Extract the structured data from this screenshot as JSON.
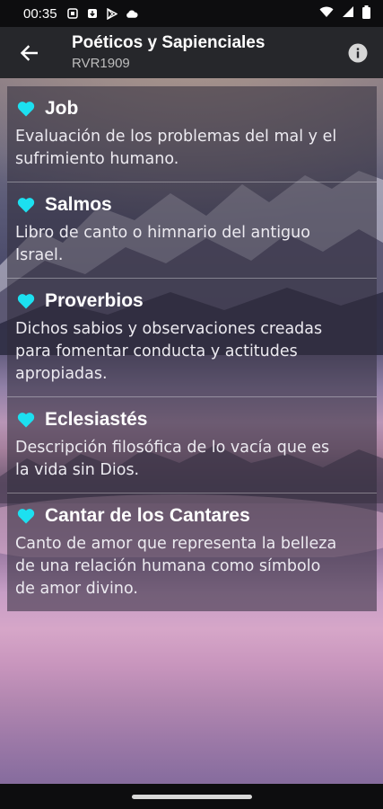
{
  "status_bar": {
    "time": "00:35",
    "icons": [
      "notification-icon",
      "download-icon",
      "play-store-icon",
      "cloud-icon",
      "wifi-icon",
      "signal-icon",
      "battery-icon"
    ]
  },
  "app_bar": {
    "title": "Poéticos y Sapienciales",
    "subtitle": "RVR1909",
    "back_icon": "arrow-left-icon",
    "info_icon": "info-icon"
  },
  "colors": {
    "accent": "#1ce0f0",
    "app_bar_bg": "#26272b",
    "status_bar_bg": "#0d0d0f"
  },
  "books": [
    {
      "name": "Job",
      "description_lines": [
        "Evaluación de los problemas del mal y el",
        "sufrimiento humano."
      ]
    },
    {
      "name": "Salmos",
      "description_lines": [
        "Libro de canto o himnario del antiguo",
        "Israel."
      ]
    },
    {
      "name": "Proverbios",
      "description_lines": [
        "Dichos sabios y observaciones creadas",
        "para fomentar conducta y actitudes",
        "apropiadas."
      ]
    },
    {
      "name": "Eclesiastés",
      "description_lines": [
        "Descripción filosófica de lo vacía que es",
        "la vida sin Dios."
      ]
    },
    {
      "name": "Cantar de los Cantares",
      "description_lines": [
        "Canto de amor que representa la belleza",
        "de una relación humana como símbolo",
        "de amor divino."
      ]
    }
  ]
}
